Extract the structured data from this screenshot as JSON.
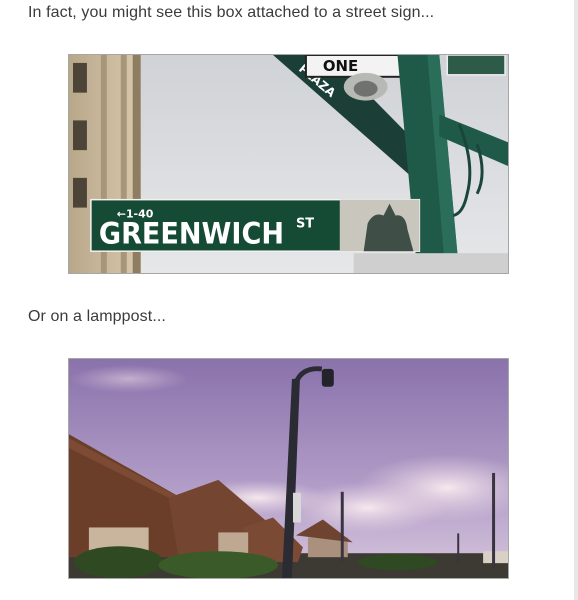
{
  "article": {
    "caption_1": "In fact, you might see this box attached to a street sign...",
    "caption_2": "Or on a lamppost..."
  },
  "photo_1": {
    "street_sign": {
      "street_name": "GREENWICH",
      "suffix": "ST",
      "route_marker": "←1-40",
      "upper_sign": "ONE"
    },
    "colors": {
      "sign_green": "#154a34",
      "pole_green": "#1f5a48",
      "sky": "#d7d9dc",
      "building": "#c8b79b"
    }
  },
  "photo_2": {
    "colors": {
      "sky_top": "#8c73ad",
      "sky_bottom": "#c9b4d6",
      "roof": "#6b3e2a",
      "pole": "#2b2b33"
    }
  }
}
